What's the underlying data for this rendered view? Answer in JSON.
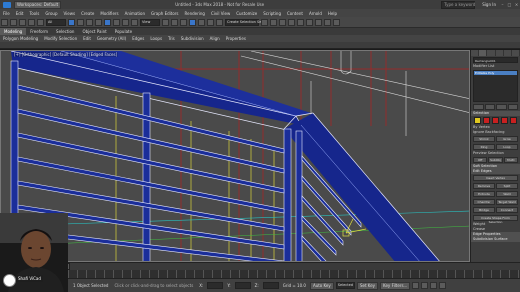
{
  "window": {
    "title": "Untitled - 3ds Max 2018 - Not for Resale Use",
    "workspace": "Workspaces: Default",
    "search_placeholder": "Type a keyword",
    "sign_in": "Sign In",
    "minimize": "–",
    "maximize": "□",
    "close": "×"
  },
  "menus": [
    "File",
    "Edit",
    "Tools",
    "Group",
    "Views",
    "Create",
    "Modifiers",
    "Animation",
    "Graph Editors",
    "Rendering",
    "Civil View",
    "Customize",
    "Scripting",
    "Content",
    "Arnold",
    "Help"
  ],
  "toolbar": {
    "undo_label": "↶",
    "redo_label": "↷",
    "selection_filter": "All",
    "view_dropdown": "View",
    "selection_set": "Create Selection Set"
  },
  "ribbon_tabs": [
    "Modeling",
    "Freeform",
    "Selection",
    "Object Paint",
    "Populate"
  ],
  "ribbon_tools": [
    "Polygon Modeling",
    "Modify Selection",
    "Edit",
    "Geometry (All)",
    "Edges",
    "Loops",
    "Tris",
    "Subdivision",
    "Align",
    "Properties"
  ],
  "viewport": {
    "label": "[+] [Orthographic] [Default Shading] [Edged Faces]",
    "colors": {
      "background": "#4a4a4a",
      "rail": "#1b2e9a",
      "wire_white": "#e8eaff",
      "wire_yellow": "#c9c23a",
      "wire_red": "#b02020"
    }
  },
  "command_panel": {
    "object_name": "Rectangle001",
    "modifier_list": "Modifier List",
    "stack_item": "Editable Poly",
    "selection_header": "Selection",
    "by_vertex": "By Vertex",
    "ignore_backfacing": "Ignore Backfacing",
    "shrink": "Shrink",
    "grow": "Grow",
    "ring": "Ring",
    "loop": "Loop",
    "preview_selection": "Preview Selection",
    "off": "Off",
    "subobj": "SubObj",
    "multi": "Multi",
    "soft_selection": "Soft Selection",
    "edit_edges": "Edit Edges",
    "insert_vertex": "Insert Vertex",
    "remove": "Remove",
    "split": "Split",
    "extrude": "Extrude",
    "weld": "Weld",
    "chamfer": "Chamfer",
    "target_weld": "Target Weld",
    "bridge": "Bridge",
    "connect": "Connect",
    "create_shape": "Create Shape From Selection",
    "weight": "Weight",
    "crease": "Crease",
    "edge_properties": "Edge Properties",
    "subdivision": "Subdivision Surface"
  },
  "timeline": {
    "frame_label": "0 / 100",
    "ticks": [
      "0",
      "10",
      "20",
      "30",
      "40",
      "50",
      "60",
      "70",
      "80",
      "90",
      "100"
    ]
  },
  "status": {
    "message": "1 Object Selected",
    "hint": "Click or click-and-drag to select objects",
    "x_label": "X:",
    "y_label": "Y:",
    "z_label": "Z:",
    "grid": "Grid = 10.0",
    "add_time_tag": "Add Time Tag",
    "auto_key": "Auto Key",
    "set_key": "Set Key",
    "selected": "Selected",
    "key_filters": "Key Filters..."
  },
  "webcam": {
    "name": "Shafi ViCad"
  }
}
